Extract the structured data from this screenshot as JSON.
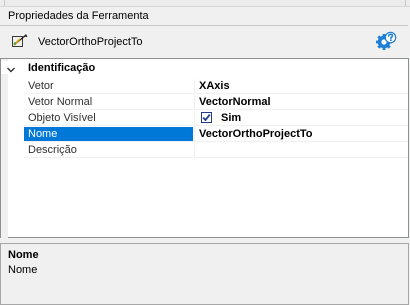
{
  "panel": {
    "title": "Propriedades da Ferramenta"
  },
  "tool": {
    "name": "VectorOrthoProjectTo",
    "icon": "vector-tool-icon",
    "help_icon": "help-gear-icon"
  },
  "category": {
    "label": "Identificação",
    "expanded": true
  },
  "properties": [
    {
      "name": "Vetor",
      "value": "XAxis",
      "selected": false
    },
    {
      "name": "Vetor Normal",
      "value": "VectorNormal",
      "selected": false
    },
    {
      "name": "Objeto Visível",
      "value": "Sim",
      "checkbox": true,
      "checked": true,
      "selected": false
    },
    {
      "name": "Nome",
      "value": "VectorOrthoProjectTo",
      "selected": true
    },
    {
      "name": "Descrição",
      "value": "",
      "selected": false
    }
  ],
  "description": {
    "title": "Nome",
    "text": "Nome"
  },
  "colors": {
    "selection": "#0078d7",
    "panel_bg": "#f0f0f0",
    "grid_bg": "#ffffff",
    "help_icon": "#1e7fd6"
  }
}
